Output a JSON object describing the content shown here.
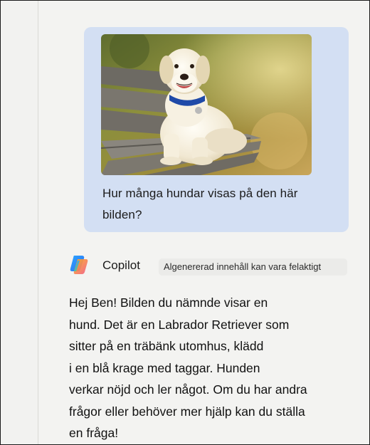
{
  "conversation": {
    "user_message": {
      "image_alt": "Labrador Retriever sitting on a wooden bench outdoors",
      "text": "Hur många hundar visas på den här bilden?"
    },
    "assistant": {
      "name": "Copilot",
      "logo_icon": "copilot-logo-icon",
      "disclaimer": "Algenererad innehåll kan vara felaktigt",
      "response_lines": [
        "Hej Ben! Bilden du nämnde visar en",
        "hund. Det är en Labrador Retriever som",
        "sitter på en träbänk utomhus, klädd",
        "i en blå krage med taggar. Hunden",
        "verkar nöjd och ler något. Om du har andra",
        "frågor eller behöver mer hjälp kan du ställa",
        "en fråga!"
      ]
    }
  },
  "colors": {
    "user_bubble": "#d3dff3",
    "background": "#f3f3f1",
    "badge": "#ebebe9",
    "collar": "#1f4aa8"
  }
}
